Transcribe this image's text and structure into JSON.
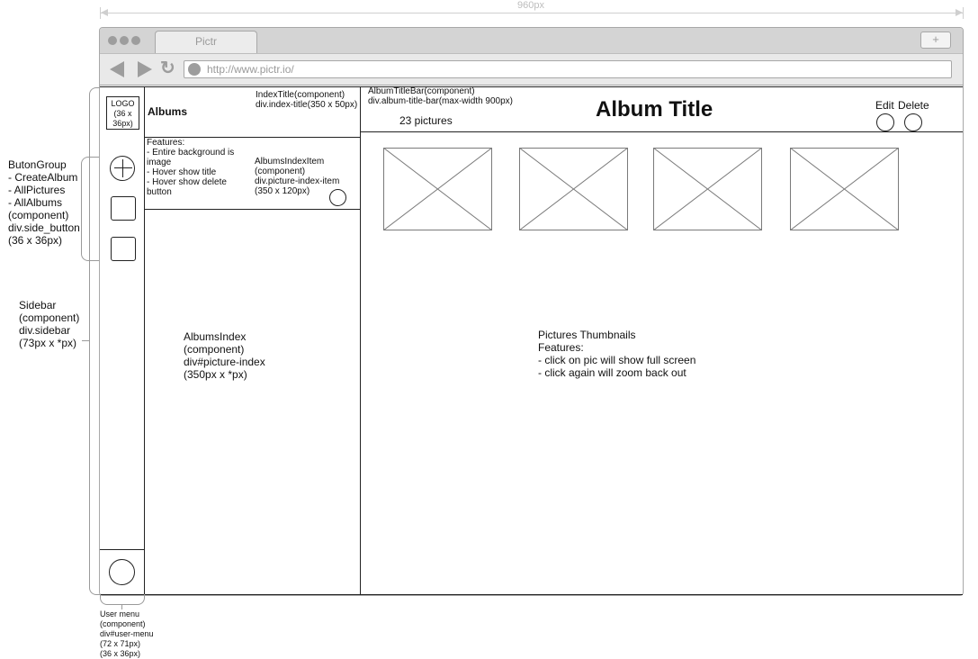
{
  "dimension": {
    "label": "960px"
  },
  "browser": {
    "tab_title": "Pictr",
    "new_tab": "+",
    "reload_icon": "reload-icon",
    "url": "http://www.pictr.io/"
  },
  "sidebar": {
    "logo_lines": [
      "LOGO",
      "(36 x",
      "36px)"
    ]
  },
  "albums_panel": {
    "title": "Albums",
    "index_title_note": [
      "IndexTitle(component)",
      "div.index-title(350 x 50px)"
    ],
    "features_note": [
      "Features:",
      "- Entire background is",
      "image",
      "- Hover show title",
      "- Hover show delete",
      "button"
    ],
    "item_note": [
      "AlbumsIndexItem",
      "(component)",
      "div.picture-index-item",
      "(350 x 120px)"
    ],
    "index_note": [
      "AlbumsIndex",
      "(component)",
      "div#picture-index",
      "(350px x *px)"
    ]
  },
  "album_bar": {
    "note": [
      "AlbumTitleBar(component)",
      "div.album-title-bar(max-width 900px)"
    ],
    "count": "23 pictures",
    "title": "Album Title",
    "edit_label": "Edit",
    "delete_label": "Delete"
  },
  "thumbnails_note": [
    "Pictures Thumbnails",
    "Features:",
    "- click on pic will show full screen",
    "- click again will zoom back out"
  ],
  "left_notes": {
    "button_group": [
      "ButonGroup",
      "- CreateAlbum",
      "- AllPictures",
      "- AllAlbums",
      "(component)",
      "div.side_button",
      "(36 x 36px)"
    ],
    "sidebar": [
      "Sidebar",
      "(component)",
      "div.sidebar",
      "(73px x *px)"
    ]
  },
  "user_menu_note": [
    "User menu",
    "(component)",
    "div#user-menu",
    "(72 x 71px)",
    "(36 x 36px)"
  ]
}
